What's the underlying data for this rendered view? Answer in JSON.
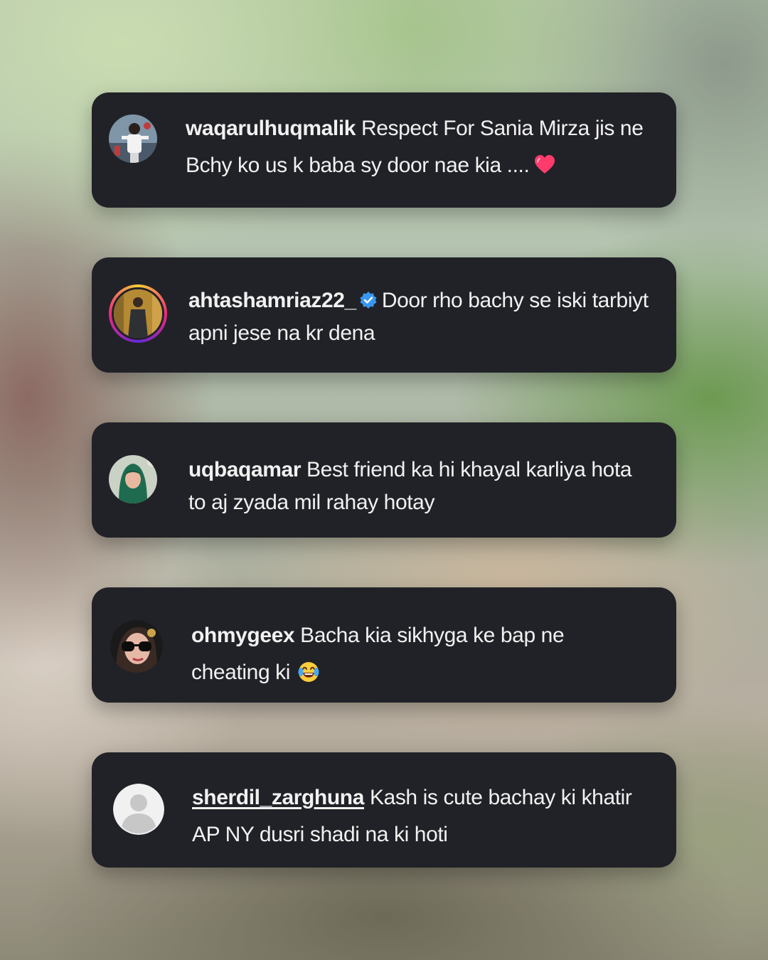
{
  "comments": [
    {
      "username": "waqarulhuqmalik",
      "verified": false,
      "text_line1": "Respect For Sania Mirza jis ne",
      "text_line2": "Bchy ko us k baba sy door nae kia ....",
      "emoji": "heart-emoji",
      "avatar": "cricket-player-avatar"
    },
    {
      "username": "ahtashamriaz22_",
      "verified": true,
      "text_line1": "Door rho bachy se iski tarbiyt",
      "text_line2": "apni jese na kr dena",
      "avatar": "story-ring-avatar"
    },
    {
      "username": "uqbaqamar",
      "verified": false,
      "text_line1": "Best friend ka hi khayal karliya hota",
      "text_line2": "to aj zyada mil rahay hotay",
      "avatar": "hijab-avatar"
    },
    {
      "username": "ohmygeex",
      "verified": false,
      "text_line1": "Bacha kia sikhyga ke bap ne",
      "text_line2": "cheating ki",
      "emoji": "tears-of-joy-emoji",
      "avatar": "sunglasses-avatar"
    },
    {
      "username": "sherdil_zarghuna",
      "verified": false,
      "text_line1": "Kash is cute bachay ki khatir",
      "text_line2": "AP NY dusri shadi na ki hoti",
      "avatar": "default-avatar"
    }
  ],
  "colors": {
    "card_background": "#212227",
    "text": "#f1f1f1",
    "verified_badge": "#3897f0",
    "heart": "#ff3b6b"
  }
}
